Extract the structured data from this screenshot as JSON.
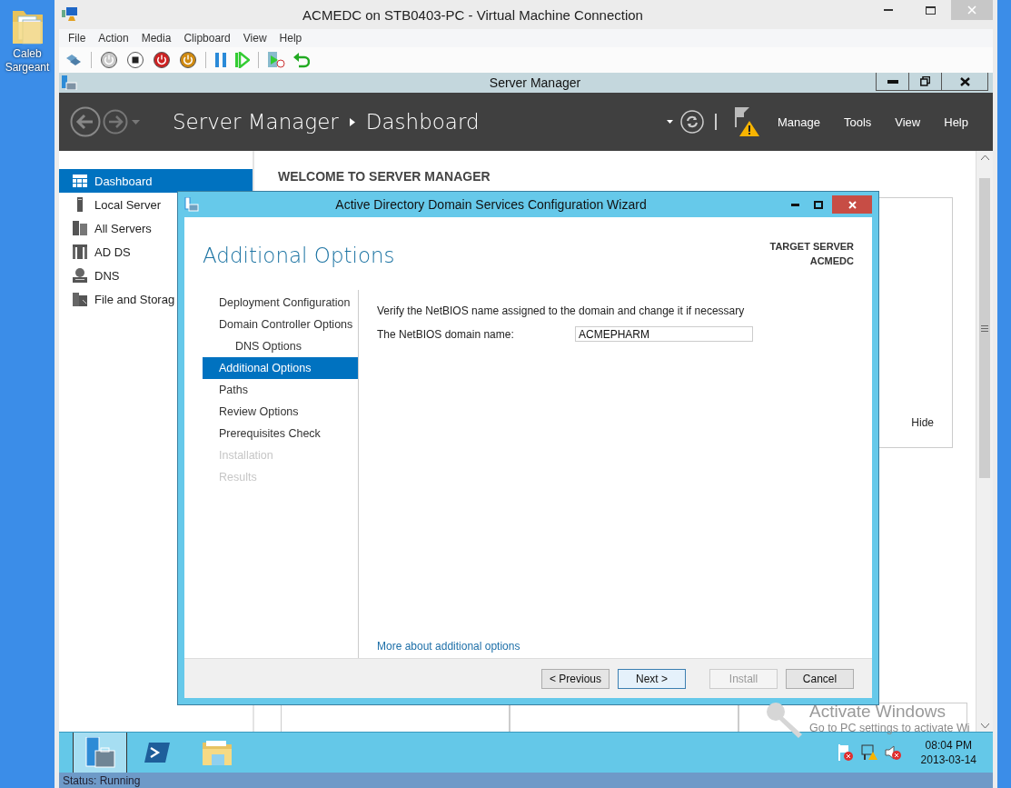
{
  "desktop_icon": {
    "label": "Caleb Sargeant"
  },
  "vm_window": {
    "title": "ACMEDC on STB0403-PC - Virtual Machine Connection",
    "menu": [
      "File",
      "Action",
      "Media",
      "Clipboard",
      "View",
      "Help"
    ],
    "status": "Status: Running"
  },
  "server_manager": {
    "title": "Server Manager",
    "breadcrumb": [
      "Server Manager",
      "Dashboard"
    ],
    "menu": [
      "Manage",
      "Tools",
      "View",
      "Help"
    ],
    "nav": [
      {
        "label": "Dashboard",
        "selected": true
      },
      {
        "label": "Local Server",
        "selected": false
      },
      {
        "label": "All Servers",
        "selected": false
      },
      {
        "label": "AD DS",
        "selected": false
      },
      {
        "label": "DNS",
        "selected": false
      },
      {
        "label": "File and Storag",
        "selected": false
      }
    ],
    "heading": "WELCOME TO SERVER MANAGER",
    "hide_link": "Hide"
  },
  "wizard": {
    "title": "Active Directory Domain Services Configuration Wizard",
    "page_title": "Additional Options",
    "target_label": "TARGET SERVER",
    "target_name": "ACMEDC",
    "steps": [
      {
        "label": "Deployment Configuration",
        "selected": false,
        "disabled": false
      },
      {
        "label": "Domain Controller Options",
        "selected": false,
        "disabled": false,
        "children": [
          {
            "label": "DNS Options",
            "selected": false,
            "disabled": false
          }
        ]
      },
      {
        "label": "Additional Options",
        "selected": true,
        "disabled": false
      },
      {
        "label": "Paths",
        "selected": false,
        "disabled": false
      },
      {
        "label": "Review Options",
        "selected": false,
        "disabled": false
      },
      {
        "label": "Prerequisites Check",
        "selected": false,
        "disabled": false
      },
      {
        "label": "Installation",
        "selected": false,
        "disabled": true
      },
      {
        "label": "Results",
        "selected": false,
        "disabled": true
      }
    ],
    "instruction": "Verify the NetBIOS name assigned to the domain and change it if necessary",
    "field_label": "The NetBIOS domain name:",
    "field_value": "ACMEPHARM",
    "help_link": "More about additional options",
    "buttons": [
      {
        "label": "< Previous",
        "disabled": false,
        "default": false
      },
      {
        "label": "Next >",
        "disabled": false,
        "default": true
      },
      {
        "label": "Install",
        "disabled": true,
        "default": false
      },
      {
        "label": "Cancel",
        "disabled": false,
        "default": false
      }
    ]
  },
  "taskbar": {
    "time": "08:04 PM",
    "date": "2013-03-14"
  },
  "activation_notice": {
    "title": "Activate Windows",
    "text": "Go to PC settings to activate Wi"
  }
}
